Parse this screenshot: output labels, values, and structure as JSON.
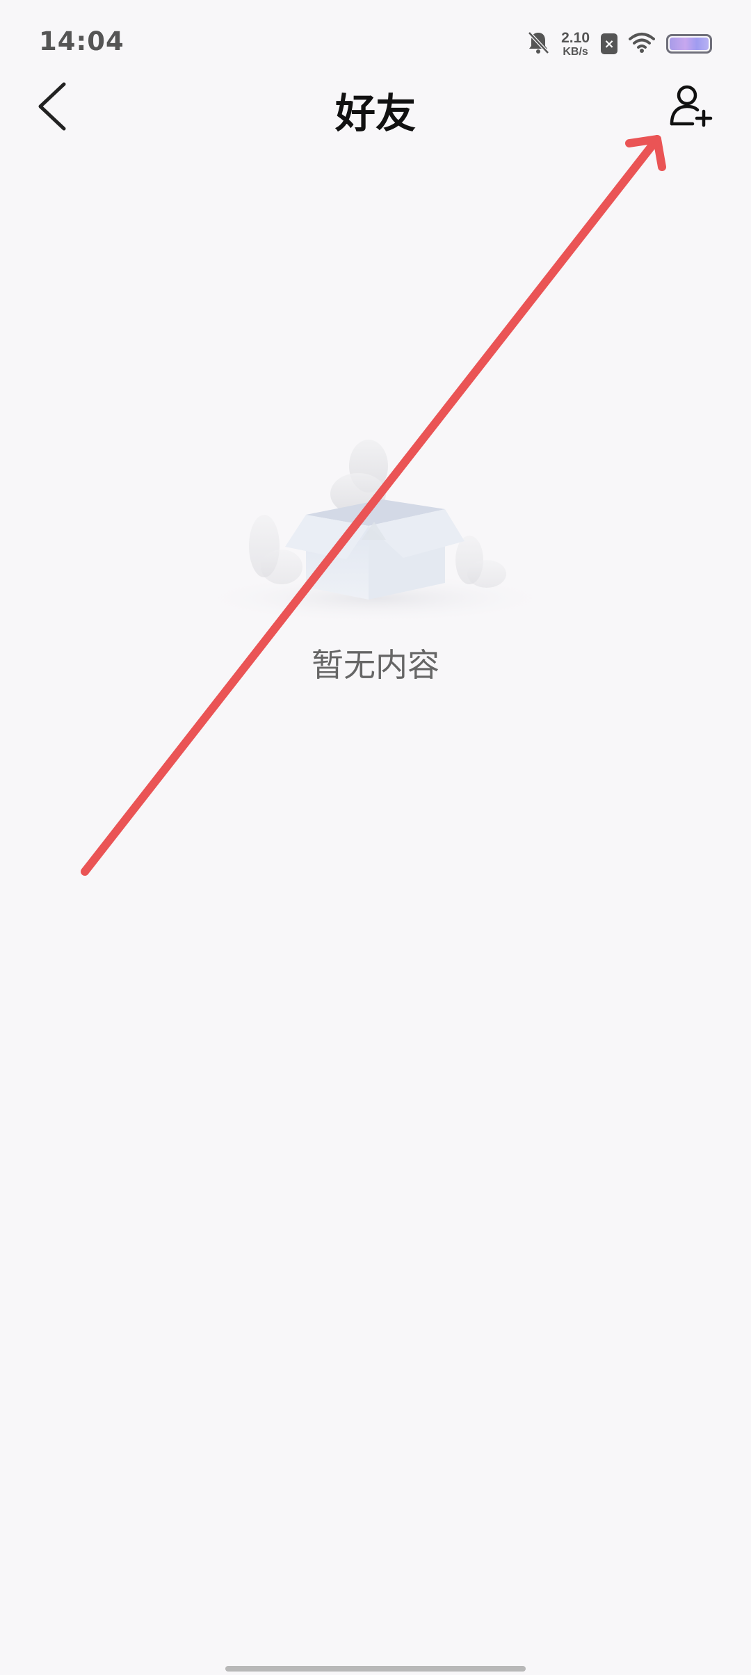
{
  "status_bar": {
    "time": "14:04",
    "net_speed_value": "2.10",
    "net_speed_unit": "KB/s",
    "sim_symbol": "×",
    "icons": [
      "bell-muted-icon",
      "sim-off-icon",
      "wifi-icon",
      "battery-icon"
    ]
  },
  "header": {
    "title": "好友",
    "back_icon": "chevron-left-icon",
    "add_icon": "add-user-icon"
  },
  "empty_state": {
    "message": "暂无内容",
    "illustration": "empty-box-illustration"
  },
  "colors": {
    "background": "#f8f7f9",
    "annotation_arrow": "#ea5455",
    "title": "#111111",
    "empty_text": "#666666"
  }
}
